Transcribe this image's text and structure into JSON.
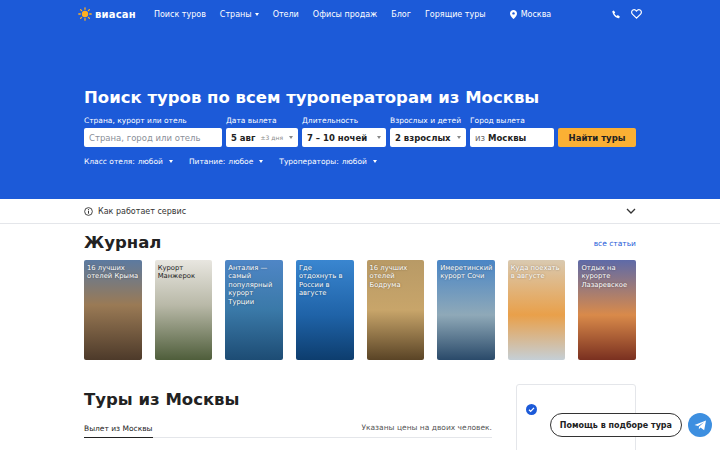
{
  "header": {
    "logo": "виасан",
    "nav": [
      {
        "label": "Поиск туров",
        "dropdown": false
      },
      {
        "label": "Страны",
        "dropdown": true
      },
      {
        "label": "Отели",
        "dropdown": false
      },
      {
        "label": "Офисы продаж",
        "dropdown": false
      },
      {
        "label": "Блог",
        "dropdown": false
      },
      {
        "label": "Горящие туры",
        "dropdown": false
      }
    ],
    "city": "Москва"
  },
  "hero": {
    "title": "Поиск туров по всем туроператорам из Москвы",
    "fields": [
      {
        "kind": "text",
        "label": "Страна, курорт или отель",
        "placeholder": "Страна, город или отель"
      },
      {
        "kind": "date",
        "label": "Дата вылета",
        "value": "5 авг",
        "hint": "±3 дня",
        "dropdown": true
      },
      {
        "kind": "select",
        "label": "Длительность",
        "value": "7 – 10 ночей",
        "dropdown": true
      },
      {
        "kind": "select",
        "label": "Взрослых и детей",
        "value": "2 взрослых",
        "dropdown": true
      },
      {
        "kind": "city",
        "label": "Город вылета",
        "prefix": "из",
        "value": "Москвы"
      }
    ],
    "button": "Найти туры",
    "filters": [
      {
        "label": "Класс отеля:",
        "value": "любой",
        "dropdown": true
      },
      {
        "label": "Питание:",
        "value": "любое",
        "dropdown": true
      },
      {
        "label": "Туроператоры:",
        "value": "любой",
        "dropdown": true
      }
    ]
  },
  "howItWorks": {
    "label": "Как работает сервис",
    "expanded": false
  },
  "journal": {
    "title": "Журнал",
    "allLink": "все статьи",
    "articles": [
      {
        "title": "16 лучших отелей Крыма"
      },
      {
        "title": "Курорт Манжерок"
      },
      {
        "title": "Анталия — самый популярный курорт Турции"
      },
      {
        "title": "Где отдохнуть в России в августе"
      },
      {
        "title": "16 лучших отелей Бодрума"
      },
      {
        "title": "Имеретинский курорт Сочи"
      },
      {
        "title": "Куда поехать в августе"
      },
      {
        "title": "Отдых на курорте Лазаревское"
      }
    ]
  },
  "tours": {
    "title": "Туры из Москвы",
    "tabs": [
      {
        "label": "Вылет из Москвы",
        "selected": true
      }
    ],
    "note": "Указаны цены на двоих человек."
  },
  "sidebar": {
    "checked": true
  },
  "help": {
    "label": "Помощь в подборе тура"
  }
}
